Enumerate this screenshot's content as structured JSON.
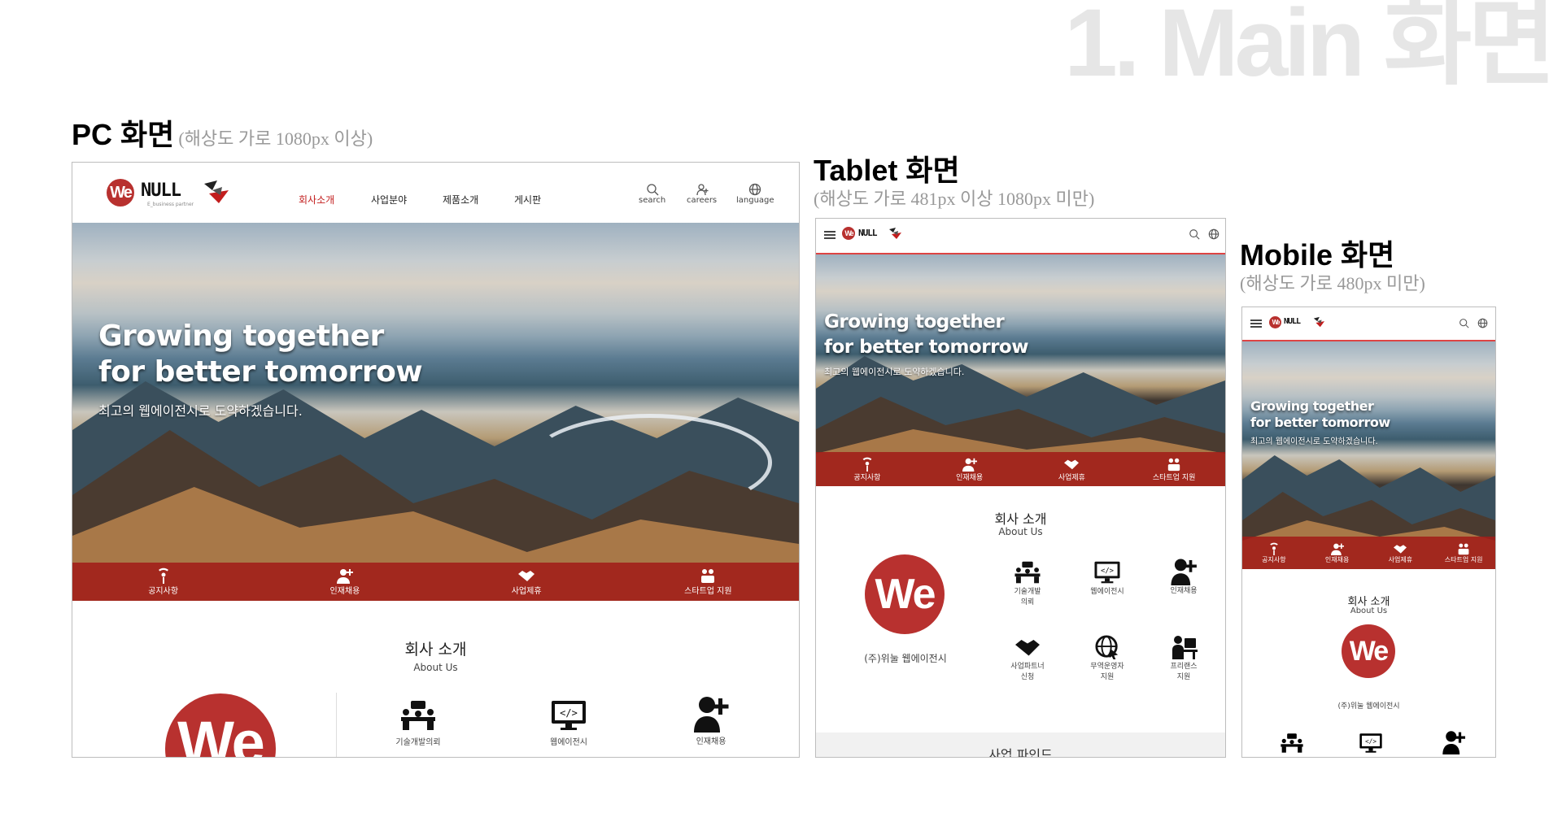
{
  "page_title": "1. Main 화면",
  "sections": {
    "pc": {
      "title": "PC 화면",
      "note": "(해상도 가로 1080px 이상)"
    },
    "tablet": {
      "title": "Tablet 화면",
      "note": "(해상도 가로 481px 이상 1080px 미만)"
    },
    "mobile": {
      "title": "Mobile 화면",
      "note": "(해상도 가로 480px 미만)"
    }
  },
  "brand": {
    "logo_we": "We",
    "logo_null": "NULL",
    "tagline": "E_business partner",
    "accent": "#c21d1d",
    "quickbar_color": "#a01c18"
  },
  "nav": {
    "items": [
      "회사소개",
      "사업분야",
      "제품소개",
      "게시판"
    ],
    "active": 0
  },
  "utility": {
    "search": "search",
    "careers": "careers",
    "language": "language"
  },
  "hero": {
    "line1": "Growing together",
    "line2": "for better tomorrow",
    "subtitle": "최고의 웹에이전시로 도약하겠습니다."
  },
  "quick_links": [
    "공지사항",
    "인재채용",
    "사업제휴",
    "스타트업 지원"
  ],
  "about": {
    "title": "회사 소개",
    "subtitle": "About Us",
    "company": "(주)위눌 웹에이전시"
  },
  "pc_services": [
    "기술개발의뢰",
    "웹에이전시",
    "인재채용"
  ],
  "tablet_services": [
    "기술개발\n의뢰",
    "웹에이전시",
    "인재채용",
    "사업파트너\n신청",
    "무역운영자\n지원",
    "프리랜스\n지원"
  ],
  "tablet_next_section": "사업 파인드"
}
